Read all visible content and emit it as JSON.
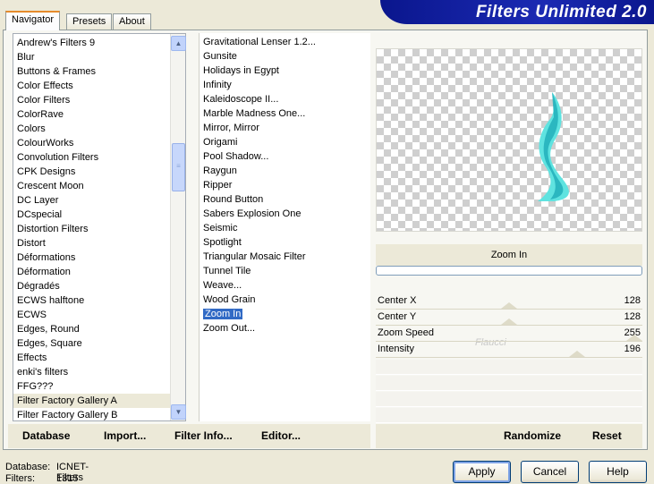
{
  "tabs": [
    "Navigator",
    "Presets",
    "About"
  ],
  "title": "Filters Unlimited 2.0",
  "categories": [
    "Andrew's Filters 9",
    "Blur",
    "Buttons & Frames",
    "Color Effects",
    "Color Filters",
    "ColorRave",
    "Colors",
    "ColourWorks",
    "Convolution Filters",
    "CPK Designs",
    "Crescent Moon",
    "DC Layer",
    "DCspecial",
    "Distortion Filters",
    "Distort",
    "Déformations",
    "Déformation",
    "Dégradés",
    "ECWS halftone",
    "ECWS",
    "Edges, Round",
    "Edges, Square",
    "Effects",
    "enki's filters",
    "FFG???",
    "Filter Factory Gallery A",
    "Filter Factory Gallery B"
  ],
  "selected_category": "Filter Factory Gallery A",
  "filters": [
    "Gravitational Lenser 1.2...",
    "Gunsite",
    "Holidays in Egypt",
    "Infinity",
    "Kaleidoscope II...",
    "Marble Madness One...",
    "Mirror, Mirror",
    "Origami",
    "Pool Shadow...",
    "Raygun",
    "Ripper",
    "Round Button",
    "Sabers Explosion One",
    "Seismic",
    "Spotlight",
    "Triangular Mosaic Filter",
    "Tunnel Tile",
    "Weave...",
    "Wood Grain",
    "Zoom In",
    "Zoom Out..."
  ],
  "selected_filter": "Zoom In",
  "preview": {
    "filter_name": "Zoom In",
    "watermark_text": "Flaucci"
  },
  "params": [
    {
      "label": "Center X",
      "value": "128",
      "level": 0.5
    },
    {
      "label": "Center Y",
      "value": "128",
      "level": 0.5
    },
    {
      "label": "Zoom Speed",
      "value": "255",
      "level": 1.0
    },
    {
      "label": "Intensity",
      "value": "196",
      "level": 0.77
    }
  ],
  "toolbar_left": {
    "database": "Database",
    "import": "Import...",
    "filter_info": "Filter Info...",
    "editor": "Editor..."
  },
  "toolbar_right": {
    "randomize": "Randomize",
    "reset": "Reset"
  },
  "status": {
    "database_label": "Database:",
    "database_value": "ICNET-Filters",
    "filters_label": "Filters:",
    "filters_value": "1315"
  },
  "buttons": {
    "apply": "Apply",
    "cancel": "Cancel",
    "help": "Help"
  },
  "colors": {
    "selection": "#316ac5",
    "banner": "#0a168d",
    "preview_shape_light": "#5fe3e0",
    "preview_shape_dark": "#1aa8b6"
  }
}
